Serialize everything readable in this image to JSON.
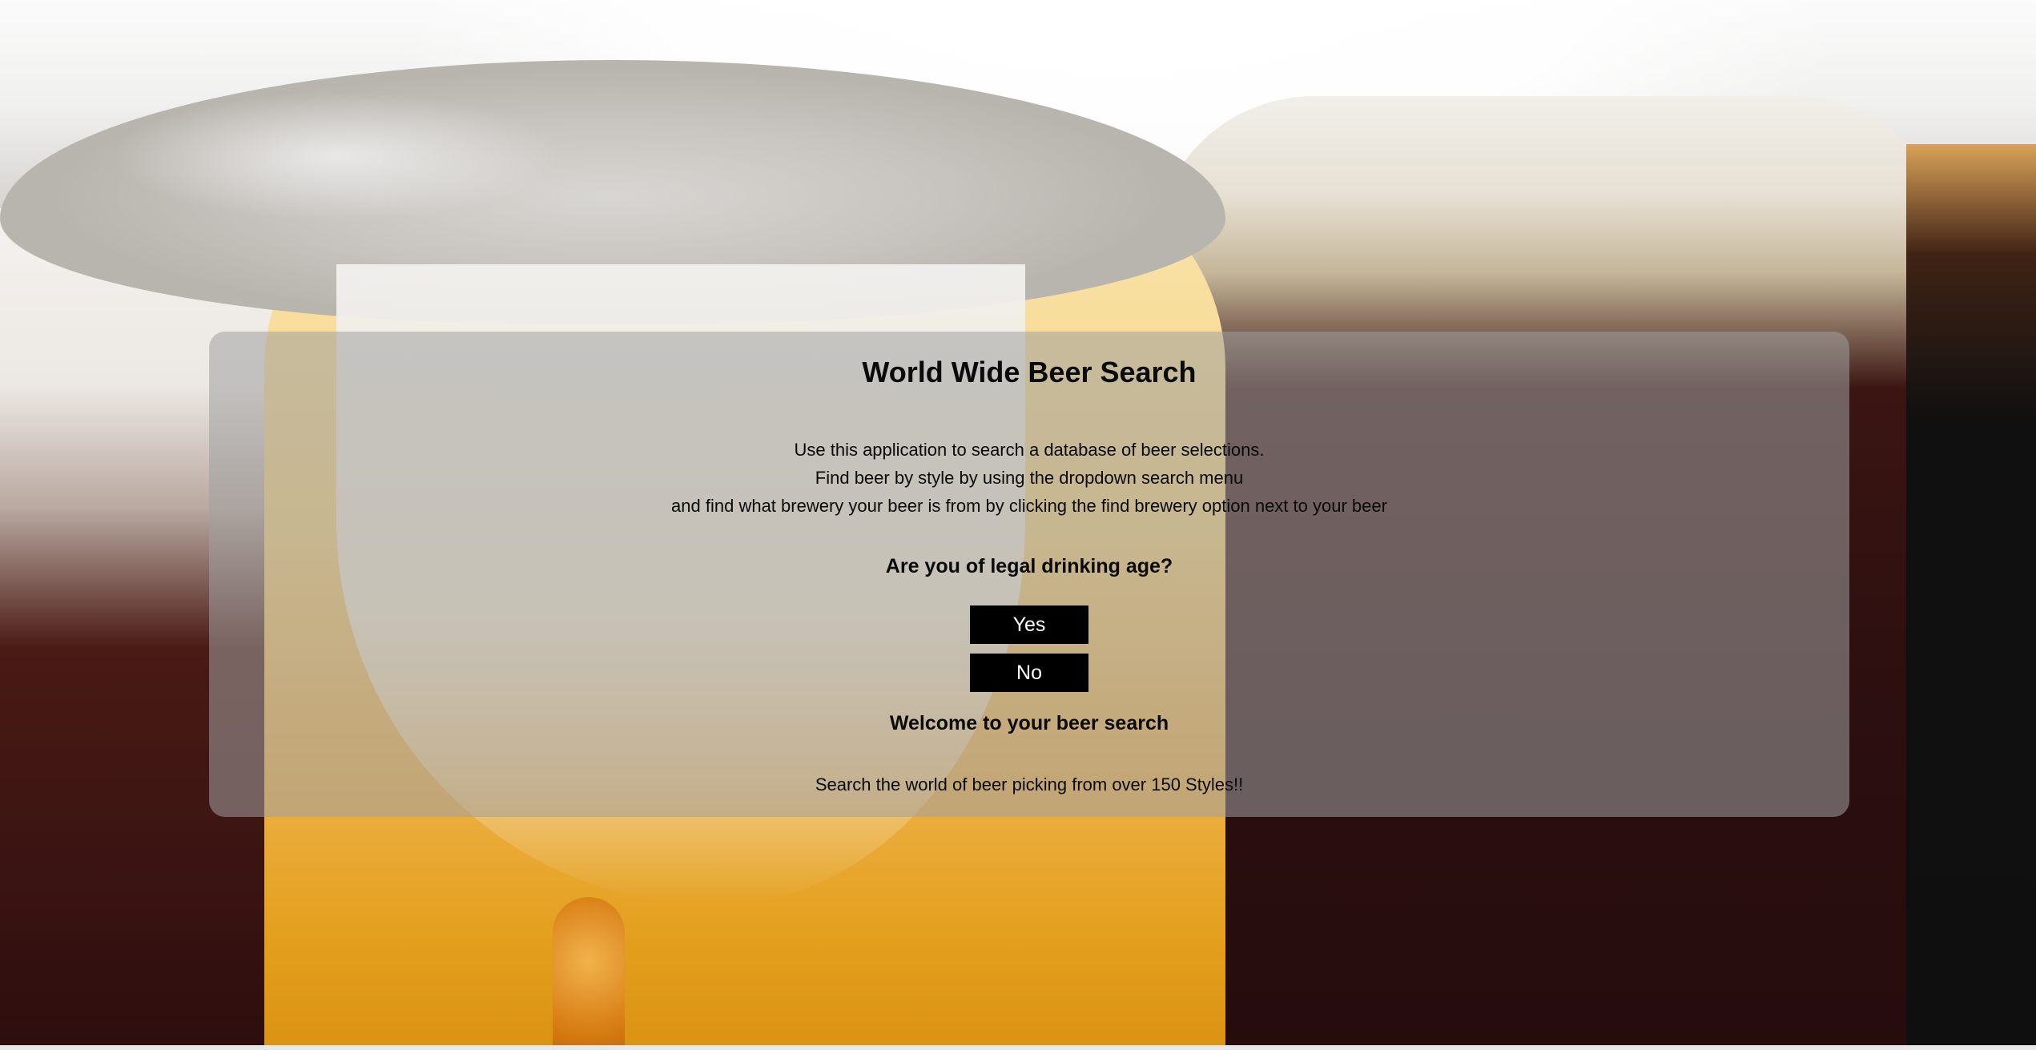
{
  "app": {
    "title": "World Wide Beer Search"
  },
  "intro": {
    "lines": [
      "Use this application to search a database of beer selections.",
      "Find beer by style by using the dropdown search menu",
      "and find what brewery your beer is from by clicking the find brewery option next to your beer"
    ]
  },
  "age_gate": {
    "question": "Are you of legal drinking age?",
    "yes_label": "Yes",
    "no_label": "No"
  },
  "welcome": {
    "heading": "Welcome to your beer search",
    "tagline": "Search the world of beer picking from over 150 Styles!!"
  },
  "colors": {
    "button_bg": "#000000",
    "button_text": "#ffffff",
    "panel_bg": "rgba(160,160,160,0.55)"
  },
  "background": {
    "image": "beer-glasses-photo"
  }
}
